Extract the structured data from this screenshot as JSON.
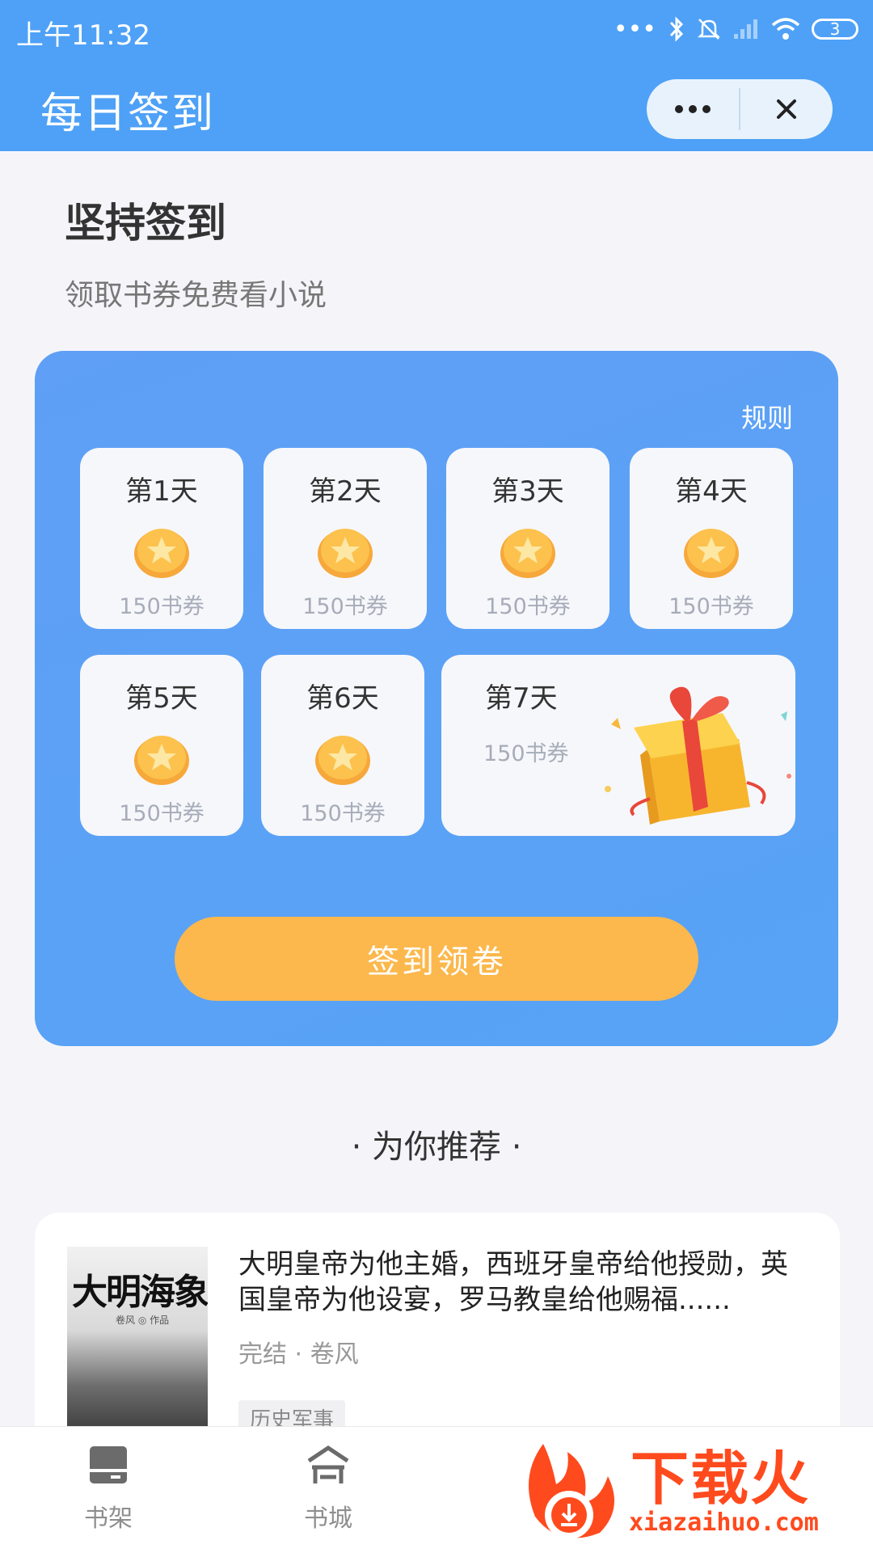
{
  "status_bar": {
    "time": "上午11:32",
    "battery": "3"
  },
  "header": {
    "title": "每日签到",
    "more_icon": "more-dots-icon",
    "close_icon": "close-icon"
  },
  "intro": {
    "heading": "坚持签到",
    "subheading": "领取书券免费看小说"
  },
  "checkin": {
    "rules_label": "规则",
    "days": [
      {
        "label": "第1天",
        "reward": "150书券"
      },
      {
        "label": "第2天",
        "reward": "150书券"
      },
      {
        "label": "第3天",
        "reward": "150书券"
      },
      {
        "label": "第4天",
        "reward": "150书券"
      },
      {
        "label": "第5天",
        "reward": "150书券"
      },
      {
        "label": "第6天",
        "reward": "150书券"
      },
      {
        "label": "第7天",
        "reward": "150书券"
      }
    ],
    "button_label": "签到领卷",
    "colors": {
      "card": "#5aa2f6",
      "button": "#fcb84c",
      "header": "#4ea1f6"
    }
  },
  "recommend": {
    "title": "· 为你推荐 ·",
    "book": {
      "cover_title": "大明海象",
      "cover_author": "卷风 ◎ 作品",
      "description": "大明皇帝为他主婚，西班牙皇帝给他授勋，英国皇帝为他设宴，罗马教皇给他赐福......",
      "meta": "完结 · 卷风",
      "tag": "历史军事"
    }
  },
  "nav": {
    "items": [
      {
        "label": "书架",
        "icon": "bookshelf-icon"
      },
      {
        "label": "书城",
        "icon": "bookstore-icon"
      }
    ]
  },
  "watermark": {
    "text": "下载火",
    "url": "xiazaihuo.com"
  }
}
